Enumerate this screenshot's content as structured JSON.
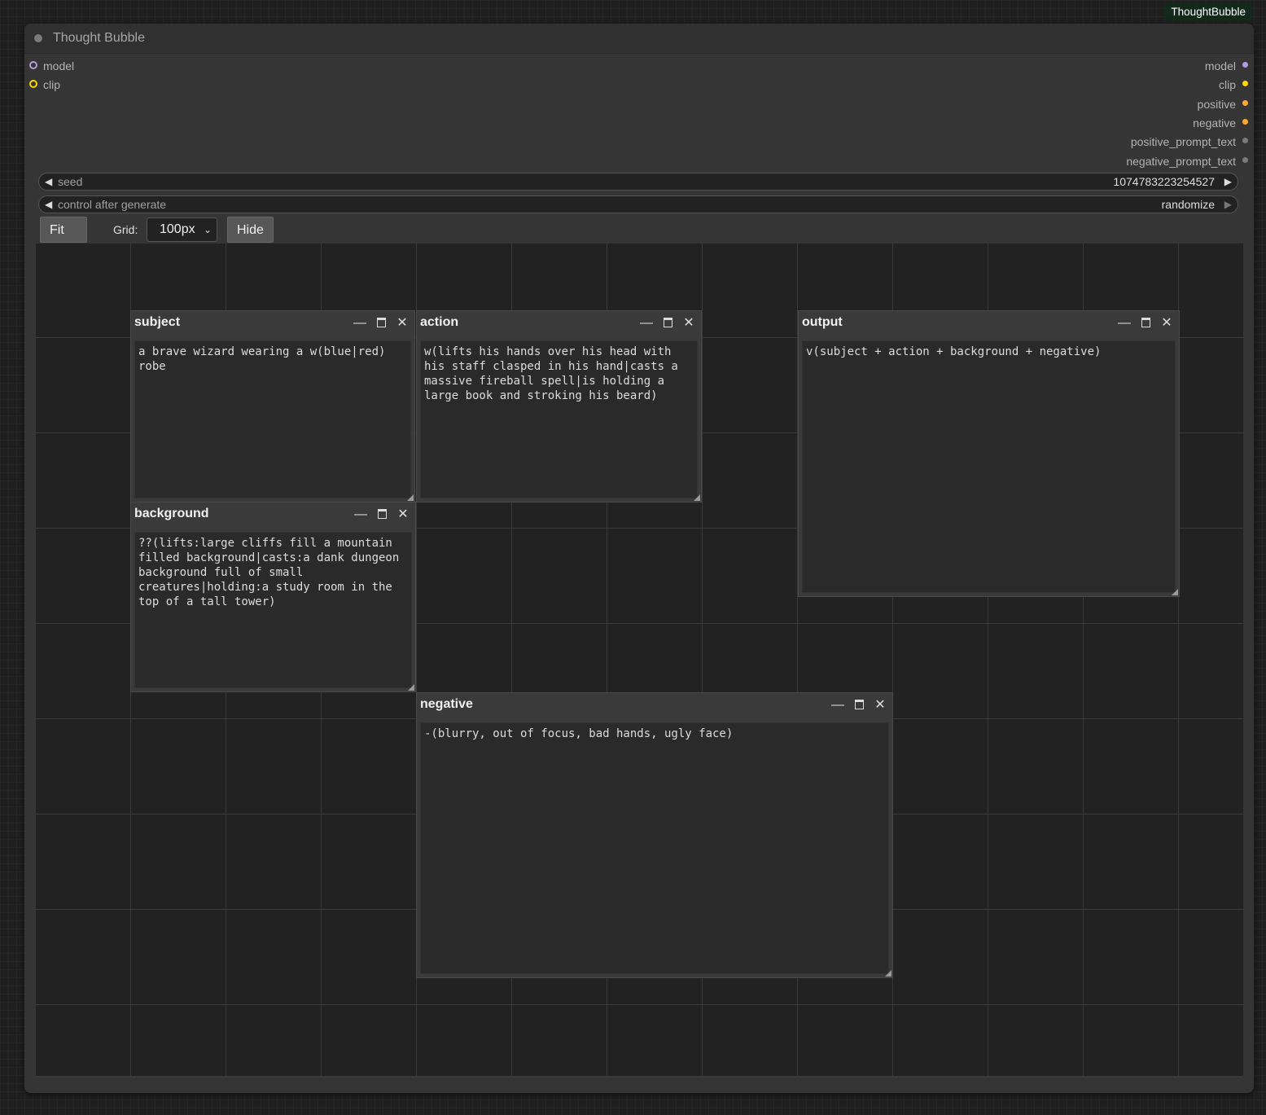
{
  "badge": "ThoughtBubble",
  "node": {
    "title": "Thought Bubble",
    "inputs": [
      {
        "label": "model",
        "type": "model"
      },
      {
        "label": "clip",
        "type": "clip"
      }
    ],
    "outputs": [
      {
        "label": "model",
        "type": "model"
      },
      {
        "label": "clip",
        "type": "clip"
      },
      {
        "label": "positive",
        "type": "conditioning"
      },
      {
        "label": "negative",
        "type": "conditioning"
      },
      {
        "label": "positive_prompt_text",
        "type": "string"
      },
      {
        "label": "negative_prompt_text",
        "type": "string"
      }
    ],
    "widgets": {
      "seed": {
        "label": "seed",
        "value": "1074783223254527"
      },
      "control": {
        "label": "control after generate",
        "value": "randomize"
      }
    }
  },
  "toolbar": {
    "fit_view": "Fit View",
    "grid_label": "Grid:",
    "grid_value": "100px",
    "hide_grid": "Hide Grid"
  },
  "windows": {
    "subject": {
      "title": "subject",
      "text": "a brave wizard wearing a w(blue|red)\nrobe"
    },
    "action": {
      "title": "action",
      "text": "w(lifts his hands over his head with\nhis staff clasped in his hand|casts a\nmassive fireball spell|is holding a\nlarge book and stroking his beard)"
    },
    "output": {
      "title": "output",
      "text": "v(subject + action + background + negative)"
    },
    "background": {
      "title": "background",
      "text": "??(lifts:large cliffs fill a mountain\nfilled background|casts:a dank dungeon\nbackground full of small\ncreatures|holding:a study room in the\ntop of a tall tower)"
    },
    "negative": {
      "title": "negative",
      "text": "-(blurry, out of focus, bad hands, ugly face)"
    }
  },
  "icons": {
    "minimize": "minimize-icon",
    "maximize": "maximize-icon",
    "close": "close-icon"
  },
  "colors": {
    "model": "#b39ddb",
    "clip": "#ffd500",
    "conditioning": "#ffa931",
    "string": "#7a7a7a"
  }
}
